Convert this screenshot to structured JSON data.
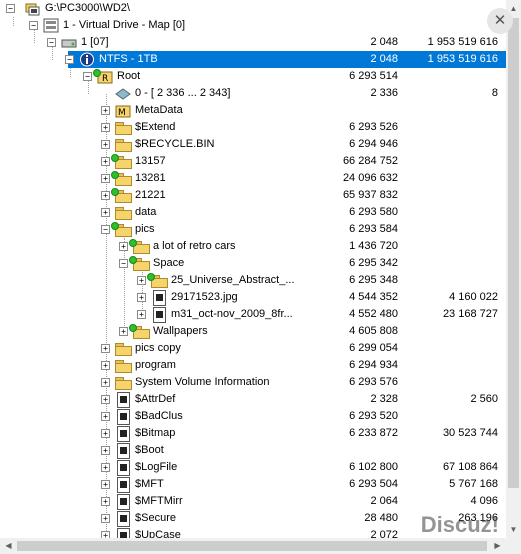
{
  "close_label": "✕",
  "watermark": "Discuz!",
  "rows": [
    {
      "label": "G:\\PC3000\\WD2\\",
      "c1": "",
      "c2": ""
    },
    {
      "label": "1 - Virtual Drive - Map [0]",
      "c1": "",
      "c2": ""
    },
    {
      "label": "1 [07]",
      "c1": "2 048",
      "c2": "1 953 519 616"
    },
    {
      "label": "NTFS - 1TB",
      "c1": "2 048",
      "c2": "1 953 519 616"
    },
    {
      "label": "Root",
      "c1": "6 293 514",
      "c2": ""
    },
    {
      "label": "0 - [  2 336 ...  2 343]",
      "c1": "2 336",
      "c2": "8"
    },
    {
      "label": "MetaData",
      "c1": "",
      "c2": ""
    },
    {
      "label": "$Extend",
      "c1": "6 293 526",
      "c2": ""
    },
    {
      "label": "$RECYCLE.BIN",
      "c1": "6 294 946",
      "c2": ""
    },
    {
      "label": "13157",
      "c1": "66 284 752",
      "c2": ""
    },
    {
      "label": "13281",
      "c1": "24 096 632",
      "c2": ""
    },
    {
      "label": "21221",
      "c1": "65 937 832",
      "c2": ""
    },
    {
      "label": "data",
      "c1": "6 293 580",
      "c2": ""
    },
    {
      "label": "pics",
      "c1": "6 293 584",
      "c2": ""
    },
    {
      "label": "a lot of retro cars",
      "c1": "1 436 720",
      "c2": ""
    },
    {
      "label": "Space",
      "c1": "6 295 342",
      "c2": ""
    },
    {
      "label": "25_Universe_Abstract_...",
      "c1": "6 295 348",
      "c2": ""
    },
    {
      "label": "29171523.jpg",
      "c1": "4 544 352",
      "c2": "4 160 022"
    },
    {
      "label": "m31_oct-nov_2009_8fr...",
      "c1": "4 552 480",
      "c2": "23 168 727"
    },
    {
      "label": "Wallpapers",
      "c1": "4 605 808",
      "c2": ""
    },
    {
      "label": "pics copy",
      "c1": "6 299 054",
      "c2": ""
    },
    {
      "label": "program",
      "c1": "6 294 934",
      "c2": ""
    },
    {
      "label": "System Volume Information",
      "c1": "6 293 576",
      "c2": ""
    },
    {
      "label": "$AttrDef",
      "c1": "2 328",
      "c2": "2 560"
    },
    {
      "label": "$BadClus",
      "c1": "6 293 520",
      "c2": ""
    },
    {
      "label": "$Bitmap",
      "c1": "6 233 872",
      "c2": "30 523 744"
    },
    {
      "label": "$Boot",
      "c1": "",
      "c2": ""
    },
    {
      "label": "$LogFile",
      "c1": "6 102 800",
      "c2": "67 108 864"
    },
    {
      "label": "$MFT",
      "c1": "6 293 504",
      "c2": "5 767 168"
    },
    {
      "label": "$MFTMirr",
      "c1": "2 064",
      "c2": "4 096"
    },
    {
      "label": "$Secure",
      "c1": "28 480",
      "c2": "263 196"
    },
    {
      "label": "$UpCase",
      "c1": "2 072",
      "c2": ""
    }
  ]
}
